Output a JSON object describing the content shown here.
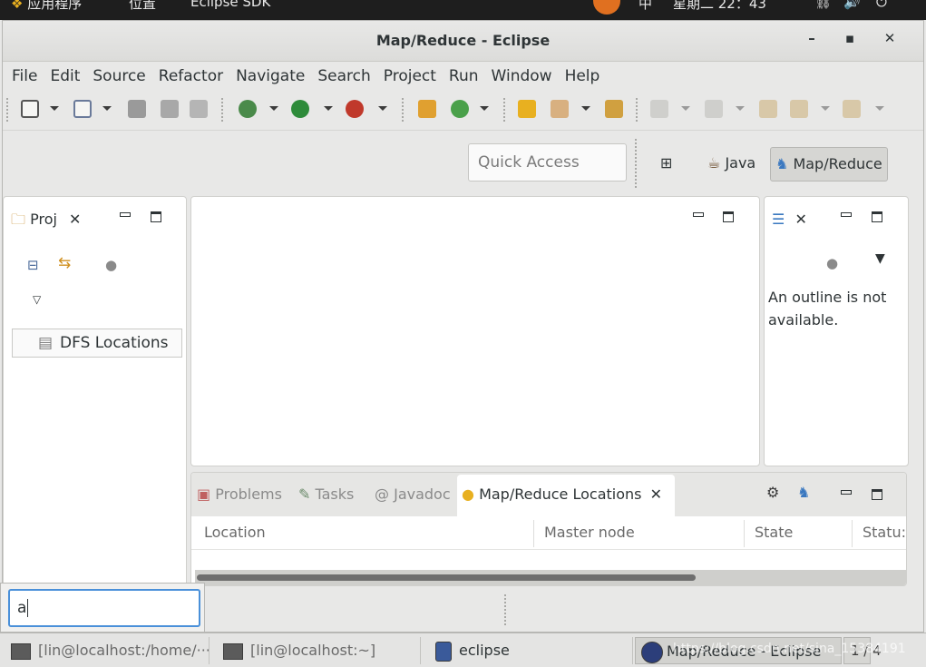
{
  "topbar": {
    "apps": "应用程序",
    "places": "位置",
    "app_name": "Eclipse SDK",
    "input_method": "中",
    "clock": "星期二 22：43"
  },
  "window": {
    "title": "Map/Reduce - Eclipse"
  },
  "menu": [
    "File",
    "Edit",
    "Source",
    "Refactor",
    "Navigate",
    "Search",
    "Project",
    "Run",
    "Window",
    "Help"
  ],
  "quick_access": {
    "placeholder": "Quick Access"
  },
  "perspectives": {
    "java": "Java",
    "mapreduce": "Map/Reduce"
  },
  "project_explorer": {
    "tab": "Proj",
    "tree_item": "DFS Locations"
  },
  "outline": {
    "message": "An outline is not available."
  },
  "bottom_panel": {
    "tabs": [
      "Problems",
      "Tasks",
      "Javadoc",
      "Map/Reduce Locations"
    ],
    "columns": [
      "Location",
      "Master node",
      "State",
      "Statu:"
    ]
  },
  "input_popup": {
    "value": "a"
  },
  "taskbar": {
    "tasks": [
      "[lin@localhost:/home/···",
      "[lin@localhost:~]",
      "eclipse",
      "Map/Reduce - Eclipse"
    ],
    "watermark": "https://blog.csdn.net/sina_15384191",
    "page_indicator": "1 / 4"
  },
  "colors": {
    "accent": "#4a90d9",
    "hadoop_yellow": "#e8b020",
    "eclipse_blue": "#2c3e7a"
  }
}
